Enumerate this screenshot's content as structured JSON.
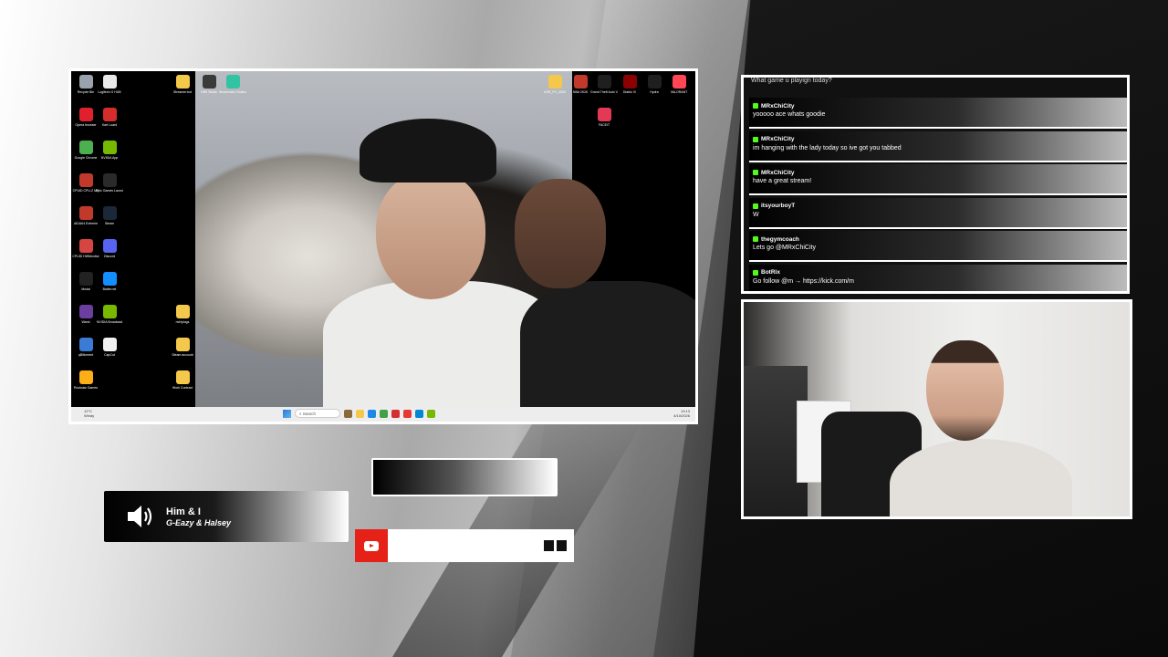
{
  "desktop": {
    "icons": [
      {
        "label": "Recycle Bin",
        "color": "#9aa3ad"
      },
      {
        "label": "Logitech G HUB",
        "color": "#e9e9e9"
      },
      {
        "label": "Streamer.bot",
        "color": "#f4c84a"
      },
      {
        "label": "OBS Studio",
        "color": "#3a3a3a"
      },
      {
        "label": "Streamlabs Chatbot",
        "color": "#31c3a2"
      },
      {
        "label": "Opera browser",
        "color": "#e0202c"
      },
      {
        "label": "Kart Loard",
        "color": "#d72c2c"
      },
      {
        "label": "Google Chrome",
        "color": "#4caf50"
      },
      {
        "label": "NVIDIA App",
        "color": "#76b900"
      },
      {
        "label": "CPUID CPU-Z MS",
        "color": "#c0392b"
      },
      {
        "label": "Epic Games Launcher",
        "color": "#2a2a2a"
      },
      {
        "label": "AIDA64 Extreme",
        "color": "#c0392b"
      },
      {
        "label": "Steam",
        "color": "#1b2838"
      },
      {
        "label": "CPUID HWMonitor",
        "color": "#d64541"
      },
      {
        "label": "Discord",
        "color": "#5865f2"
      },
      {
        "label": "Modal",
        "color": "#222"
      },
      {
        "label": "Battle.net",
        "color": "#148eff"
      },
      {
        "label": "Wand",
        "color": "#6b3fa0"
      },
      {
        "label": "NVIDIA Broadcast",
        "color": "#76b900"
      },
      {
        "label": "nvhlplugs",
        "color": "#f4c84a"
      },
      {
        "label": "qBittorrent",
        "color": "#3a7bd5"
      },
      {
        "label": "CapCut",
        "color": "#f1f1f1"
      },
      {
        "label": "Steam account",
        "color": "#f4c84a"
      },
      {
        "label": "Rockstar Games",
        "color": "#fcaf17"
      },
      {
        "label": "Work Contract",
        "color": "#f4c84a"
      },
      {
        "label": "ASR_PC_3000",
        "color": "#f4c84a"
      },
      {
        "label": "NBA 2K26",
        "color": "#c0392b"
      },
      {
        "label": "Grand Theft Auto V",
        "color": "#1f1f1f"
      },
      {
        "label": "Diablo IV",
        "color": "#8b0000"
      },
      {
        "label": "Hydra",
        "color": "#1f1f1f"
      },
      {
        "label": "VALORANT",
        "color": "#ff4655"
      },
      {
        "label": "FACEIT",
        "color": "#e33955"
      }
    ],
    "taskbar": {
      "weather_temp": "12°C",
      "weather_desc": "Windy",
      "search_placeholder": "Search",
      "apps": [
        "#8a6a3a",
        "#f4c84a",
        "#1e88e5",
        "#43a047",
        "#d32f2f",
        "#e53935",
        "#0288d1",
        "#76b900"
      ],
      "time": "13:13",
      "date": "4/10/2026"
    }
  },
  "chat": {
    "top_partial": "What game u playign today?",
    "messages": [
      {
        "user": "MRxChiCity",
        "text": "yooooo ace whats goodie"
      },
      {
        "user": "MRxChiCity",
        "text": "im hanging with the lady today so ive got you tabbed"
      },
      {
        "user": "MRxChiCity",
        "text": "have a great stream!"
      },
      {
        "user": "itsyourboyT",
        "text": "W"
      },
      {
        "user": "thegymcoach",
        "text": "Lets go @MRxChiCity"
      },
      {
        "user": "BotRix",
        "text": "Go follow @m → https://kick.com/m"
      }
    ]
  },
  "now_playing": {
    "title": "Him & I",
    "artist": "G-Eazy & Halsey"
  },
  "youtube_bar": {
    "icon": "youtube-icon"
  }
}
